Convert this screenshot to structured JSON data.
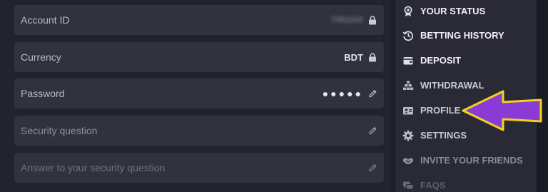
{
  "form": {
    "fields": [
      {
        "label": "Account ID",
        "value": "7061102",
        "icon": "lock-icon"
      },
      {
        "label": "Currency",
        "value": "BDT",
        "icon": "lock-icon"
      },
      {
        "label": "Password",
        "value": "●●●●●",
        "icon": "pencil-icon"
      },
      {
        "label": "Security question",
        "value": "",
        "icon": "pencil-icon"
      },
      {
        "label": "Answer to your security question",
        "value": "",
        "icon": "pencil-icon"
      }
    ]
  },
  "menu": {
    "items": [
      {
        "label": "YOUR STATUS",
        "icon": "medal-icon"
      },
      {
        "label": "BETTING HISTORY",
        "icon": "history-icon"
      },
      {
        "label": "DEPOSIT",
        "icon": "wallet-icon"
      },
      {
        "label": "WITHDRAWAL",
        "icon": "coins-stack-icon"
      },
      {
        "label": "PROFILE",
        "icon": "id-card-icon"
      },
      {
        "label": "SETTINGS",
        "icon": "gear-icon"
      },
      {
        "label": "INVITE YOUR FRIENDS",
        "icon": "handshake-icon"
      },
      {
        "label": "FAQS",
        "icon": "chat-icon"
      }
    ]
  },
  "annotation": {
    "arrow_color": "#8a3bd6",
    "arrow_outline": "#f2d31a"
  }
}
